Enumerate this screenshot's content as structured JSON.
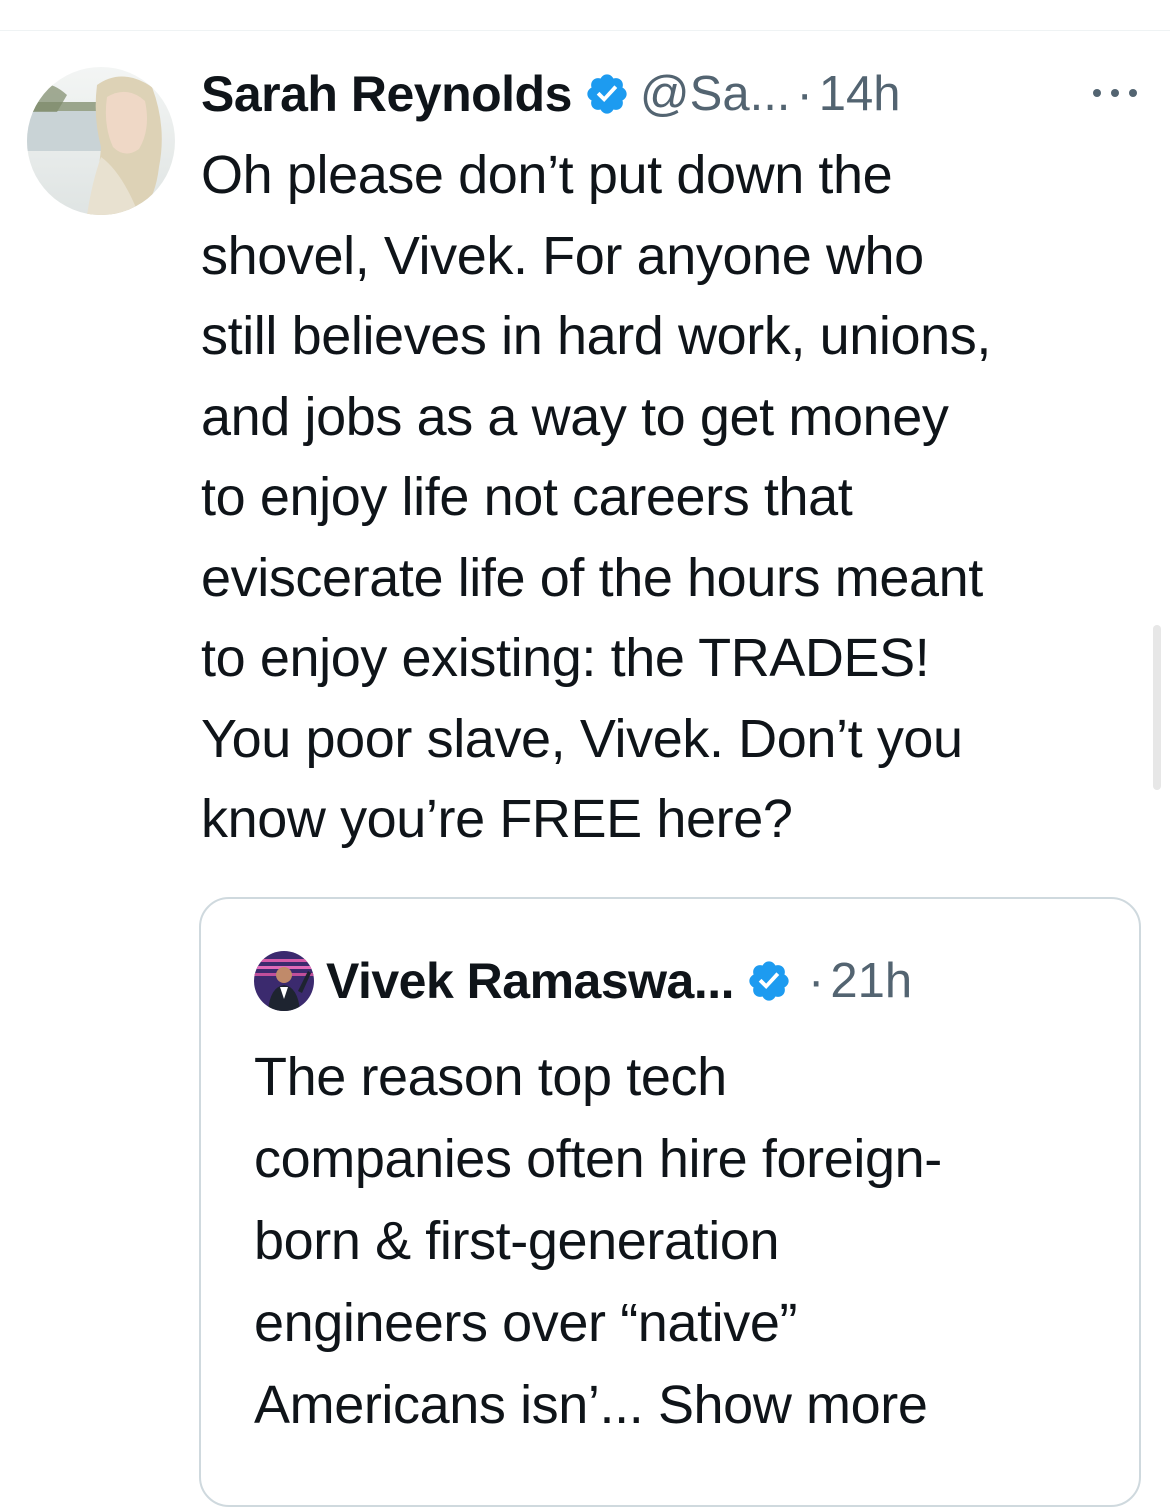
{
  "tweet": {
    "author_name": "Sarah Reynolds",
    "handle": "@Sa...",
    "separator": "·",
    "time": "14h",
    "verified_icon": "verified-badge-icon",
    "more_icon": "more-options-icon",
    "text": "Oh please don’t put down the\nshovel, Vivek. For anyone who\nstill believes in hard work, unions,\nand jobs as a way to get money\nto enjoy life not careers that\neviscerate life of the hours meant\nto enjoy existing: the TRADES!\nYou poor slave, Vivek. Don’t you\nknow you’re FREE here?"
  },
  "quoted_tweet": {
    "author_name": "Vivek Ramaswa...",
    "separator": "·",
    "time": "21h",
    "verified_icon": "verified-badge-icon",
    "text_main": "The reason top tech\ncompanies often hire foreign-\nborn & first-generation\nengineers over “native”\nAmericans isn’...",
    "show_more_label": "Show more"
  },
  "colors": {
    "verified_blue": "#1d9bf0",
    "muted_text": "#536471",
    "card_border": "#cfd9de",
    "text": "#0f1419"
  }
}
